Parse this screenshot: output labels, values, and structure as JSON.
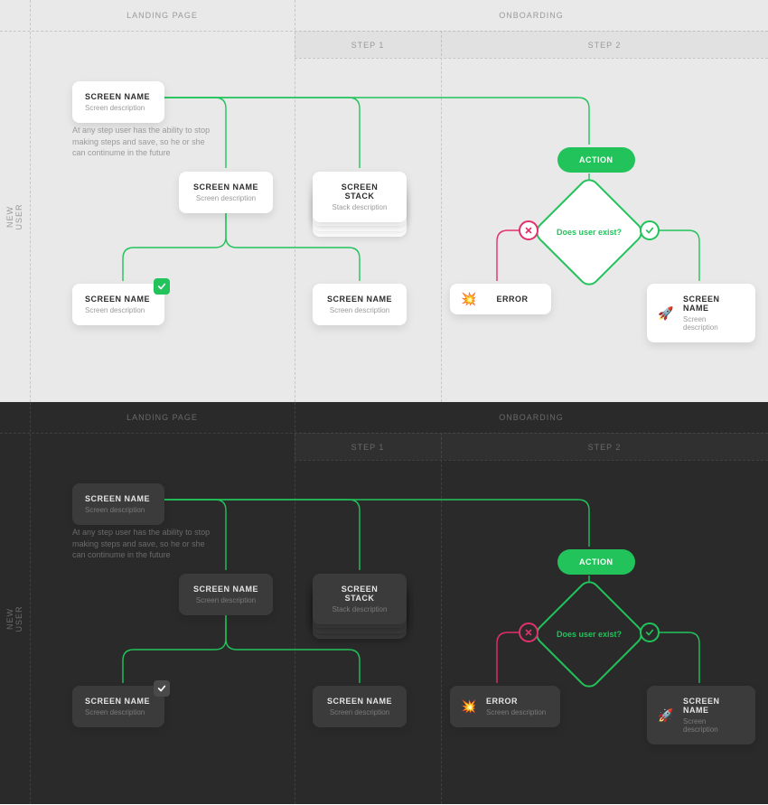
{
  "colors": {
    "accent": "#21C35A",
    "danger": "#E1306C"
  },
  "columns": {
    "landing": "LANDING PAGE",
    "onboarding": "ONBOARDING",
    "step1": "STEP 1",
    "step2": "STEP 2"
  },
  "rows": {
    "new_user": "NEW USER"
  },
  "note": "At any step user has the ability to stop making steps and save, so he or she can continume in the future",
  "cards": {
    "start": {
      "title": "SCREEN NAME",
      "desc": "Screen description"
    },
    "mid": {
      "title": "SCREEN NAME",
      "desc": "Screen description"
    },
    "stack": {
      "title": "SCREEN STACK",
      "desc": "Stack description"
    },
    "leaf_ok": {
      "title": "SCREEN NAME",
      "desc": "Screen description"
    },
    "leaf_plain": {
      "title": "SCREEN NAME",
      "desc": "Screen description"
    },
    "error": {
      "title": "ERROR",
      "desc": "Screen description",
      "icon": "💥"
    },
    "final": {
      "title": "SCREEN NAME",
      "desc": "Screen description",
      "icon": "🚀"
    }
  },
  "action": {
    "label": "ACTION"
  },
  "decision": {
    "question": "Does user exist?"
  },
  "choices": {
    "yes": "yes",
    "no": "no"
  }
}
